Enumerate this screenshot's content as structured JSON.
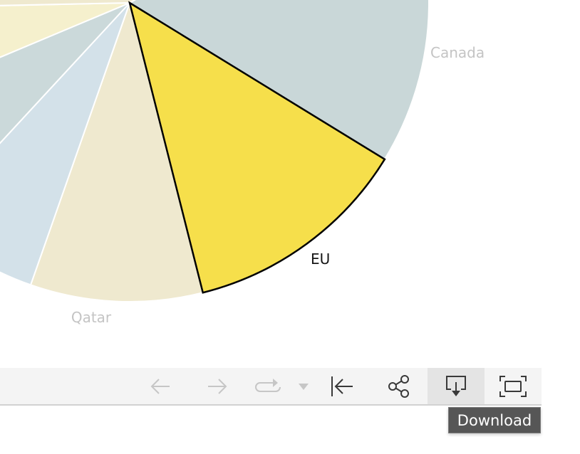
{
  "chart_data": {
    "type": "pie",
    "title": "",
    "start_angle_deg": -30,
    "slices": [
      {
        "label": "Canada",
        "share": 0.171,
        "color": "#c9d7d8",
        "label_visible": true,
        "label_color": "#c4c4c4",
        "highlighted": false
      },
      {
        "label": "EU",
        "share": 0.123,
        "color": "#f6df4b",
        "label_visible": true,
        "label_color": "#161616",
        "highlighted": true
      },
      {
        "label": "Qatar",
        "share": 0.093,
        "color": "#efe9cf",
        "label_visible": true,
        "label_color": "#c4c4c4",
        "highlighted": false
      },
      {
        "label": "",
        "share": 0.065,
        "color": "#d3e1e9",
        "label_visible": false,
        "highlighted": false
      },
      {
        "label": "",
        "share": 0.068,
        "color": "#cbd9da",
        "label_visible": false,
        "highlighted": false
      },
      {
        "label": "",
        "share": 0.06,
        "color": "#f5f0cd",
        "label_visible": false,
        "highlighted": false
      },
      {
        "label": "",
        "share": 0.42,
        "color": "#efe9cf",
        "label_visible": false,
        "highlighted": false
      }
    ]
  },
  "toolbar": {
    "buttons": [
      {
        "name": "undo-button",
        "icon": "arrow-left-icon",
        "enabled": false,
        "tooltip": ""
      },
      {
        "name": "redo-button",
        "icon": "arrow-right-icon",
        "enabled": false,
        "tooltip": ""
      },
      {
        "name": "replay-button",
        "icon": "replay-icon",
        "enabled": false,
        "tooltip": ""
      },
      {
        "name": "replay-dropdown",
        "icon": "caret-down-icon",
        "enabled": false,
        "tooltip": ""
      },
      {
        "name": "reset-button",
        "icon": "arrow-to-start-icon",
        "enabled": true,
        "tooltip": ""
      },
      {
        "name": "share-button",
        "icon": "share-icon",
        "enabled": true,
        "tooltip": ""
      },
      {
        "name": "download-button",
        "icon": "download-icon",
        "enabled": true,
        "tooltip": "Download"
      },
      {
        "name": "fullscreen-button",
        "icon": "fullscreen-icon",
        "enabled": true,
        "tooltip": ""
      }
    ],
    "active_tooltip": "Download"
  },
  "colors": {
    "toolbar_bg": "#f4f4f4",
    "active_button_bg": "#e4e4e4",
    "icon_enabled": "#393939",
    "icon_disabled": "#c6c6c6",
    "tooltip_bg": "#565656"
  }
}
